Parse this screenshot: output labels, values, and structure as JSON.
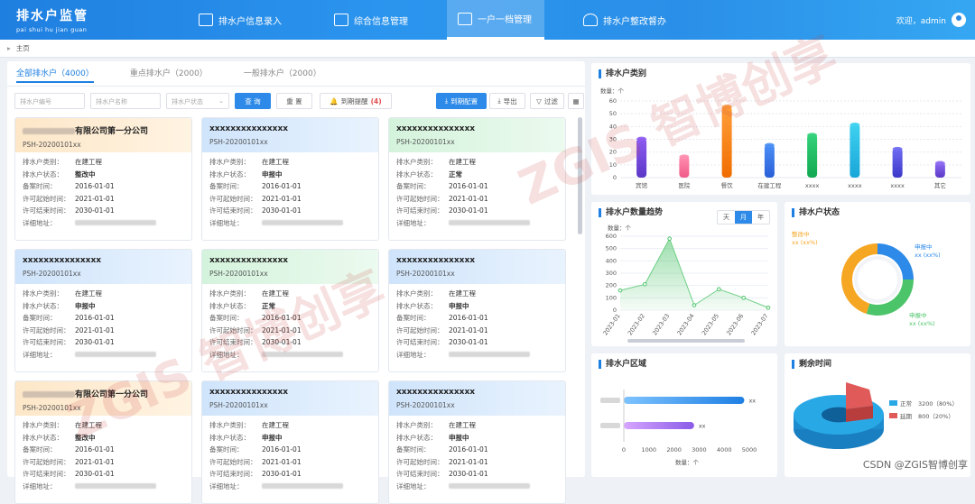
{
  "header": {
    "title": "排水户监管",
    "subtitle": "pai shui hu jian guan",
    "nav": [
      {
        "label": "排水户信息录入"
      },
      {
        "label": "综合信息管理"
      },
      {
        "label": "一户一档管理"
      },
      {
        "label": "排水户整改督办"
      }
    ],
    "user": "欢迎，admin"
  },
  "breadcrumb": "主页",
  "tabs": [
    "全部排水户（4000）",
    "重点排水户（2000）",
    "一般排水户（2000）"
  ],
  "filters": {
    "code_placeholder": "排水户编号",
    "name_placeholder": "排水户名称",
    "status_placeholder": "排水户状态",
    "search": "查 询",
    "reset": "重 置",
    "reminder": "到期提醒",
    "reminder_count": "(4)",
    "batch": "到期配置",
    "export": "导出",
    "filter": "过滤"
  },
  "card_labels": {
    "type": "排水户类别：",
    "status": "排水户状态：",
    "record": "备案时间：",
    "start": "许可起始时间：",
    "end": "许可结束时间：",
    "addr": "详细地址："
  },
  "cards": [
    {
      "title": "有限公司第一分公司",
      "code": "PSH-20200101xx",
      "type": "在建工程",
      "status": "整改中",
      "record": "2016-01-01",
      "start": "2021-01-01",
      "end": "2030-01-01"
    },
    {
      "title": "xxxxxxxxxxxxxxx",
      "code": "PSH-20200101xx",
      "type": "在建工程",
      "status": "申报中",
      "record": "2016-01-01",
      "start": "2021-01-01",
      "end": "2030-01-01"
    },
    {
      "title": "xxxxxxxxxxxxxxx",
      "code": "PSH-20200101xx",
      "type": "在建工程",
      "status": "正常",
      "record": "2016-01-01",
      "start": "2021-01-01",
      "end": "2030-01-01"
    },
    {
      "title": "xxxxxxxxxxxxxxx",
      "code": "PSH-20200101xx",
      "type": "在建工程",
      "status": "申报中",
      "record": "2016-01-01",
      "start": "2021-01-01",
      "end": "2030-01-01"
    },
    {
      "title": "xxxxxxxxxxxxxxx",
      "code": "PSH-20200101xx",
      "type": "在建工程",
      "status": "正常",
      "record": "2016-01-01",
      "start": "2021-01-01",
      "end": "2030-01-01"
    },
    {
      "title": "xxxxxxxxxxxxxxx",
      "code": "PSH-20200101xx",
      "type": "在建工程",
      "status": "申报中",
      "record": "2016-01-01",
      "start": "2021-01-01",
      "end": "2030-01-01"
    },
    {
      "title": "有限公司第一分公司",
      "code": "PSH-20200101xx",
      "type": "在建工程",
      "status": "整改中",
      "record": "2016-01-01",
      "start": "2021-01-01",
      "end": "2030-01-01"
    },
    {
      "title": "xxxxxxxxxxxxxxx",
      "code": "PSH-20200101xx",
      "type": "在建工程",
      "status": "申报中",
      "record": "2016-01-01",
      "start": "2021-01-01",
      "end": "2030-01-01"
    },
    {
      "title": "xxxxxxxxxxxxxxx",
      "code": "PSH-20200101xx",
      "type": "在建工程",
      "status": "申报中",
      "record": "2016-01-01",
      "start": "2021-01-01",
      "end": "2030-01-01"
    }
  ],
  "panels": {
    "category": "排水户类别",
    "trend": "排水户数量趋势",
    "status": "排水户状态",
    "region": "排水户区域",
    "remaining": "剩余时间",
    "seg": [
      "天",
      "月",
      "年"
    ]
  },
  "chart_data": [
    {
      "type": "bar",
      "title": "排水户类别",
      "ylabel": "数量：个",
      "categories": [
        "宾馆",
        "医院",
        "餐饮",
        "在建工程",
        "xxxx",
        "xxxx",
        "xxxx",
        "其它"
      ],
      "values": [
        31,
        17,
        56,
        26,
        34,
        42,
        23,
        12
      ],
      "ylim": [
        0,
        60
      ],
      "yticks": [
        0,
        10,
        20,
        30,
        40,
        50,
        60
      ]
    },
    {
      "type": "area",
      "title": "排水户数量趋势",
      "ylabel": "数量：个",
      "categories": [
        "2023-01",
        "2023-02",
        "2023-03",
        "2023-04",
        "2023-05",
        "2023-06",
        "2023-07"
      ],
      "values": [
        160,
        210,
        580,
        40,
        170,
        100,
        20
      ],
      "ylim": [
        0,
        600
      ],
      "yticks": [
        0,
        100,
        200,
        300,
        400,
        500,
        600
      ]
    },
    {
      "type": "pie",
      "title": "排水户状态",
      "series": [
        {
          "name": "申报中",
          "label": "xx (xx%)",
          "value": 25,
          "color": "#2d8ae8"
        },
        {
          "name": "申报中",
          "label": "xx (xx%)",
          "value": 30,
          "color": "#4cc46a"
        },
        {
          "name": "整改中",
          "label": "xx (xx%)",
          "value": 45,
          "color": "#f5a623"
        }
      ]
    },
    {
      "type": "bar",
      "title": "排水户区域",
      "xlabel": "数量：个",
      "values": [
        4800,
        2800
      ],
      "data_labels": [
        "xx",
        "xx"
      ],
      "xlim": [
        0,
        5000
      ],
      "xticks": [
        0,
        1000,
        2000,
        3000,
        4000,
        5000
      ]
    },
    {
      "type": "pie",
      "title": "剩余时间",
      "series": [
        {
          "name": "正常",
          "value": 3200,
          "label": "3200（80%）",
          "color": "#29a8e6"
        },
        {
          "name": "延期",
          "value": 800,
          "label": "800（20%）",
          "color": "#e05a5a"
        }
      ]
    }
  ],
  "watermark": "ZGIS 智博创享",
  "credit": "CSDN @ZGIS智博创享"
}
